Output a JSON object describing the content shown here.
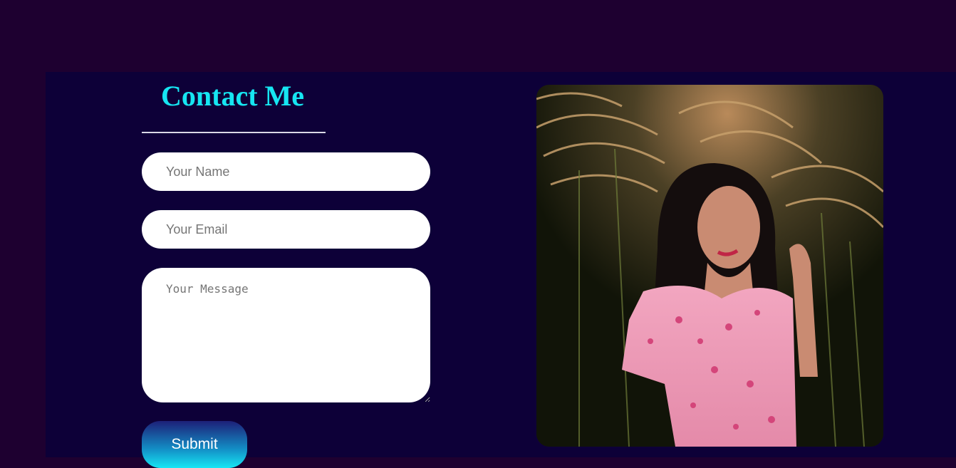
{
  "contact": {
    "title": "Contact Me",
    "name_placeholder": "Your Name",
    "email_placeholder": "Your Email",
    "message_placeholder": "Your Message",
    "submit_label": "Submit"
  },
  "photo": {
    "subject": "portrait-photo"
  },
  "colors": {
    "page_background": "#1e0030",
    "panel_background": "#0d0038",
    "title_color": "#16e6f2",
    "button_gradient_top": "#1d2078",
    "button_gradient_bottom": "#17e6f4"
  }
}
